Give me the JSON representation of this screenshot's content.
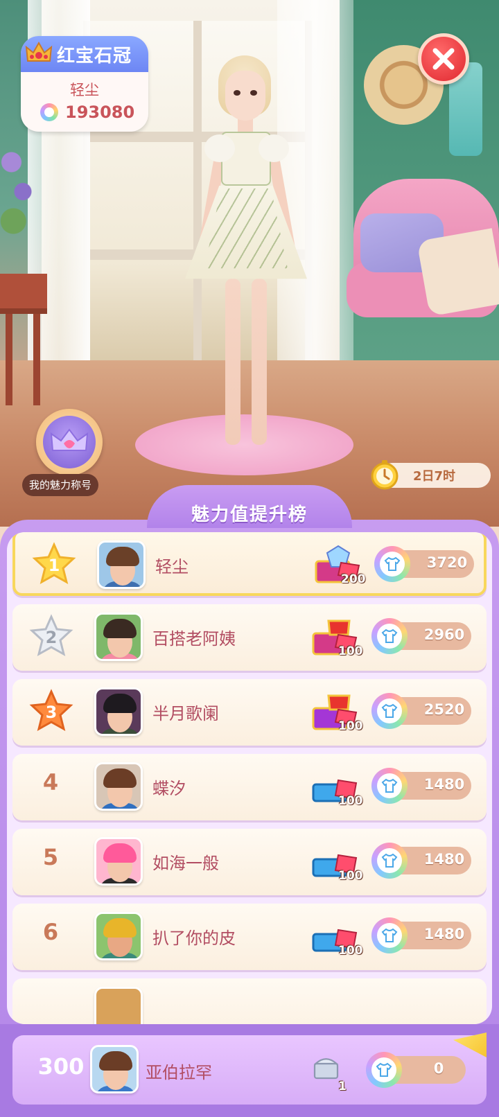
{
  "player_card": {
    "title": "红宝石冠",
    "name": "轻尘",
    "score": "193080"
  },
  "charm_title_label": "我的魅力称号",
  "timer_text": "2日7时",
  "board": {
    "title": "魅力值提升榜",
    "rows": [
      {
        "rank": "1",
        "name": "轻尘",
        "chest_count": "200",
        "charm": "3720"
      },
      {
        "rank": "2",
        "name": "百搭老阿姨",
        "chest_count": "100",
        "charm": "2960"
      },
      {
        "rank": "3",
        "name": "半月歌阑",
        "chest_count": "100",
        "charm": "2520"
      },
      {
        "rank": "4",
        "name": "蝶汐",
        "chest_count": "100",
        "charm": "1480"
      },
      {
        "rank": "5",
        "name": "如海一般",
        "chest_count": "100",
        "charm": "1480"
      },
      {
        "rank": "6",
        "name": "扒了你的皮",
        "chest_count": "100",
        "charm": "1480"
      }
    ]
  },
  "self_row": {
    "rank": "300",
    "name": "亚伯拉罕",
    "chest_count": "1",
    "charm": "0"
  },
  "icons": {
    "close": "close-icon",
    "crown": "crown-icon",
    "timer": "alarm-clock-icon",
    "charm_coin": "shirt-coin-icon"
  },
  "colors": {
    "panel_purple": "#b387e8",
    "name_red": "#b24d62",
    "gold_star": "#f8d75c",
    "close_red": "#e0272f"
  }
}
